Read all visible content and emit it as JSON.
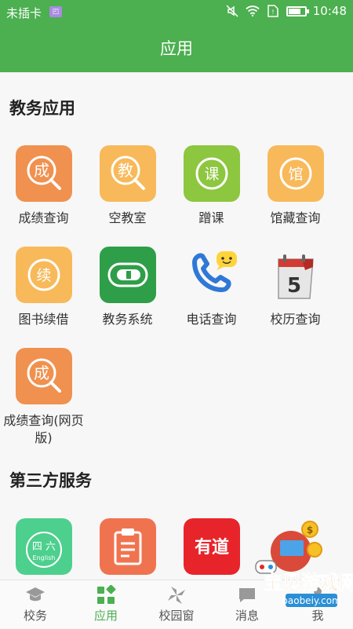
{
  "status": {
    "carrier": "未插卡",
    "time": "10:48"
  },
  "header": {
    "title": "应用"
  },
  "sections": [
    {
      "title": "教务应用"
    },
    {
      "title": "第三方服务"
    }
  ],
  "academic_apps": [
    {
      "label": "成绩查询",
      "glyph": "成",
      "icon": "grade-search-icon",
      "color": "#f0914f"
    },
    {
      "label": "空教室",
      "glyph": "教",
      "icon": "classroom-search-icon",
      "color": "#f8b95a"
    },
    {
      "label": "蹭课",
      "glyph": "课",
      "icon": "course-icon",
      "color": "#8dc63f"
    },
    {
      "label": "馆藏查询",
      "glyph": "馆",
      "icon": "library-icon",
      "color": "#f8b95a"
    },
    {
      "label": "图书续借",
      "glyph": "续",
      "icon": "renew-icon",
      "color": "#f8b95a"
    },
    {
      "label": "教务系统",
      "glyph": "",
      "icon": "academic-system-icon",
      "color": "#2f9e48"
    },
    {
      "label": "电话查询",
      "glyph": "",
      "icon": "phone-icon",
      "color": "#ffffff"
    },
    {
      "label": "校历查询",
      "glyph": "5",
      "icon": "calendar-icon",
      "color": "#ffffff"
    },
    {
      "label": "成绩查询(网页版)",
      "glyph": "成",
      "icon": "grade-search-web-icon",
      "color": "#f0914f"
    }
  ],
  "third_party_apps": [
    {
      "glyph": "四 六",
      "sub": "English",
      "icon": "cet-icon",
      "color": "#4dcf8e"
    },
    {
      "glyph": "",
      "icon": "clipboard-icon",
      "color": "#f0734f"
    },
    {
      "glyph": "有道",
      "icon": "youdao-icon",
      "color": "#e8242b"
    },
    {
      "glyph": "",
      "icon": "coins-icon",
      "color": "#ffffff"
    }
  ],
  "tabs": [
    {
      "label": "校务",
      "icon": "graduation-cap-icon"
    },
    {
      "label": "应用",
      "icon": "apps-grid-icon"
    },
    {
      "label": "校园窗",
      "icon": "pinwheel-icon"
    },
    {
      "label": "消息",
      "icon": "message-icon"
    },
    {
      "label": "我",
      "icon": "person-icon"
    }
  ],
  "watermark": {
    "title": "宝贝游戏网",
    "url": "baobeiy.com"
  }
}
